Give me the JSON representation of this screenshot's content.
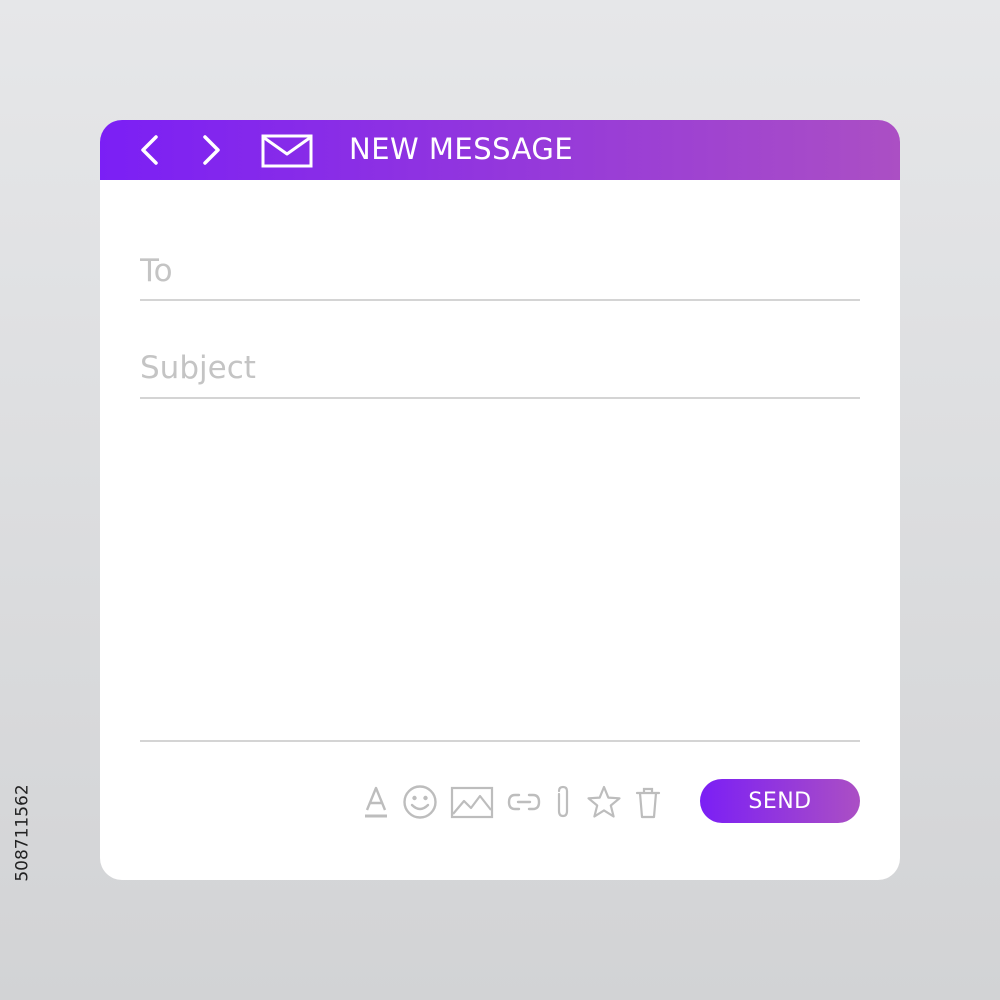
{
  "window": {
    "title": "NEW MESSAGE",
    "gradient_start": "#7B1FF5",
    "gradient_end": "#AB4FC4"
  },
  "icons": {
    "back": "chevron-left-icon",
    "forward": "chevron-right-icon",
    "mail": "envelope-icon",
    "toolbar": [
      "text-format-icon",
      "emoji-icon",
      "image-icon",
      "link-icon",
      "attachment-icon",
      "star-icon",
      "trash-icon"
    ]
  },
  "fields": {
    "to_placeholder": "To",
    "to_value": "",
    "subject_placeholder": "Subject",
    "subject_value": "",
    "body_value": ""
  },
  "actions": {
    "send_label": "SEND"
  },
  "colors": {
    "placeholder": "#C4C4C4",
    "divider": "#D4D4D4",
    "toolbar_icon": "#BDBDBD",
    "background_top": "#E6E7E9",
    "background_bottom": "#D2D3D5"
  },
  "stock_id": "508711562"
}
